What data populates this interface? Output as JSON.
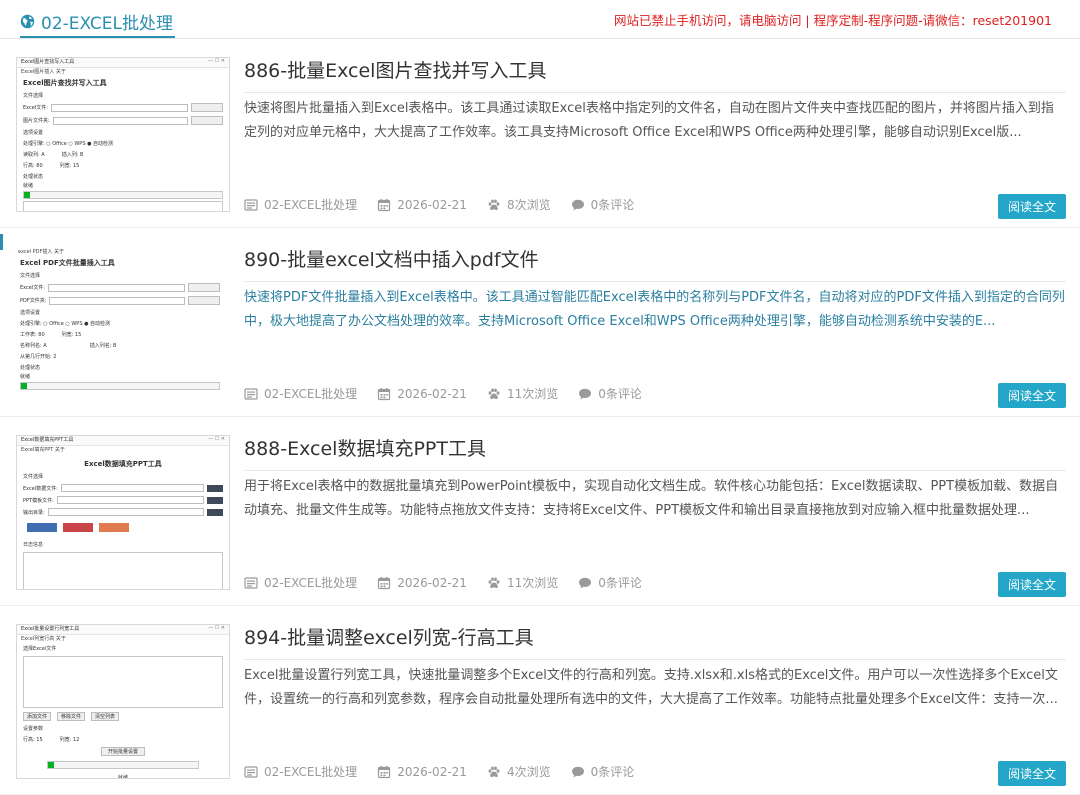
{
  "header": {
    "category": "02-EXCEL批处理",
    "notice": "网站已禁止手机访问，请电脑访问 | 程序定制-程序问题-请微信：reset201901"
  },
  "read_more": "阅读全文",
  "posts": [
    {
      "title": "886-批量Excel图片查找并写入工具",
      "desc": "快速将图片批量插入到Excel表格中。该工具通过读取Excel表格中指定列的文件名，自动在图片文件夹中查找匹配的图片，并将图片插入到指定列的对应单元格中，大大提高了工作效率。该工具支持Microsoft Office Excel和WPS Office两种处理引擎，能够自动识别Excel版...",
      "category": "02-EXCEL批处理",
      "date": "2026-02-21",
      "views": "8次浏览",
      "comments": "0条评论",
      "thumb": {
        "win_title": "Excel图片查找写入工具",
        "menu": "Excel图片插入  关于",
        "heading": "Excel图片查找并写入工具",
        "section1": "文件选择",
        "label_excel": "Excel文件:",
        "label_img": "图片文件夹:",
        "browse": "浏览",
        "section2": "选项设置",
        "engine": "处理引擎: ○ Office  ○ WPS  ● 自动检测",
        "sheet": "读取列: A",
        "insert_col": "插入列: B",
        "row_h": "行高: 80",
        "col_w": "列宽: 15",
        "status": "处理状态",
        "ready": "就绪"
      }
    },
    {
      "title": "890-批量excel文档中插入pdf文件",
      "desc": "快速将PDF文件批量插入到Excel表格中。该工具通过智能匹配Excel表格中的名称列与PDF文件名，自动将对应的PDF文件插入到指定的合同列中，极大地提高了办公文档处理的效率。支持Microsoft Office Excel和WPS Office两种处理引擎，能够自动检测系统中安装的E...",
      "category": "02-EXCEL批处理",
      "date": "2026-02-21",
      "views": "11次浏览",
      "comments": "0条评论",
      "thumb": {
        "menu": "excel PDF插入  关于",
        "heading": "Excel PDF文件批量插入工具",
        "section1": "文件选择",
        "label_excel": "Excel文件:",
        "label_pdf": "PDF文件夹:",
        "browse": "浏览",
        "section2": "选项设置",
        "engine": "处理引擎: ○ Office  ○ WPS  ● 自动检测",
        "sheet": "工作表: 80",
        "name_col": "列宽: 15",
        "match_col": "名称列名: A",
        "insert_col": "插入列名: B",
        "start_row": "从第几行开始: 2",
        "status": "处理状态",
        "ready": "就绪"
      }
    },
    {
      "title": "888-Excel数据填充PPT工具",
      "desc": "用于将Excel表格中的数据批量填充到PowerPoint模板中，实现自动化文档生成。软件核心功能包括：Excel数据读取、PPT模板加载、数据自动填充、批量文件生成等。功能特点拖放文件支持：支持将Excel文件、PPT模板文件和输出目录直接拖放到对应输入框中批量数据处理...",
      "category": "02-EXCEL批处理",
      "date": "2026-02-21",
      "views": "11次浏览",
      "comments": "0条评论",
      "thumb": {
        "win_title": "Excel数据填充PPT工具",
        "menu": "Excel填充PPT  关于",
        "heading": "Excel数据填充PPT工具",
        "section1": "文件选择",
        "label_excel": "Excel数据文件:",
        "label_ppt": "PPT模板文件:",
        "label_out": "输出目录:",
        "browse": "浏览",
        "log": "日志信息"
      }
    },
    {
      "title": "894-批量调整excel列宽-行高工具",
      "desc": "Excel批量设置行列宽工具，快速批量调整多个Excel文件的行高和列宽。支持.xlsx和.xls格式的Excel文件。用户可以一次性选择多个Excel文件，设置统一的行高和列宽参数，程序会自动批量处理所有选中的文件，大大提高了工作效率。功能特点批量处理多个Excel文件：支持一次...",
      "category": "02-EXCEL批处理",
      "date": "2026-02-21",
      "views": "4次浏览",
      "comments": "0条评论",
      "thumb": {
        "win_title": "Excel批量设置行列宽工具",
        "menu": "Excel列宽行高  关于",
        "section1": "选择Excel文件",
        "add": "添加文件",
        "remove": "移除文件",
        "clear": "清空列表",
        "section2": "设置参数",
        "row_h": "行高: 15",
        "col_w": "列宽: 12",
        "start": "开始批量设置",
        "ready": "就绪"
      }
    }
  ]
}
